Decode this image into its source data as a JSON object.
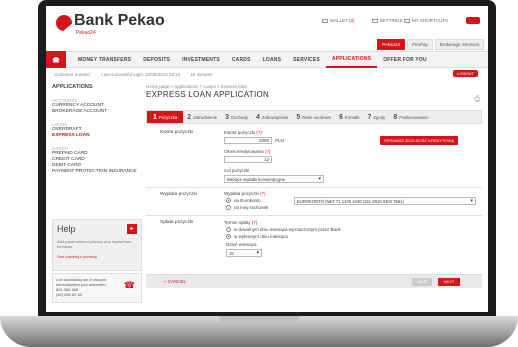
{
  "brand": {
    "name": "Bank Pekao",
    "sub": "Pekao24"
  },
  "util": {
    "wallet_label": "WALLET",
    "wallet_count": "(3)",
    "settings_label": "SETTINGS",
    "management_label": "MY SHORTCUTS"
  },
  "top_tabs": [
    "Pekao24",
    "PeoPay",
    "Brokerage Services"
  ],
  "nav": [
    "MONEY TRANSFERS",
    "DEPOSITS",
    "INVESTMENTS",
    "CARDS",
    "LOANS",
    "SERVICES",
    "APPLICATIONS",
    "OFFER FOR YOU"
  ],
  "info": {
    "customer": "Customer number:",
    "last_login": "Last successful login: 22/05/2014 08:23",
    "session": "15 minutes"
  },
  "logout_label": "LOGOUT",
  "sidebar": {
    "head": "APPLICATIONS",
    "groups": [
      {
        "title": "ACCOUNTS",
        "items": [
          "CURRENCY ACCOUNT",
          "BROKERAGE ACCOUNT"
        ]
      },
      {
        "title": "LOANS",
        "items": [
          "OVERDRAFT",
          "EXPRESS LOAN"
        ]
      },
      {
        "title": "CARDS",
        "items": [
          "PREPAID CARD",
          "CREDIT CARD",
          "DEBIT CARD",
          "PAYMENT PROTECTION INSURANCE"
        ]
      }
    ]
  },
  "help": {
    "title": "Help",
    "text": "Add parametrized primary any mysterious formulas",
    "link": "See udzieliq z pomocy"
  },
  "contact": {
    "text": "Lub skontaktuj sie z naszym konsultantem pod numerem:",
    "phone1": "801 365 365",
    "phone2": "(42) 683 82 82"
  },
  "main": {
    "breadcrumb": "Home page > Applications > Loans > Express loan",
    "title": "EXPRESS LOAN APPLICATION",
    "steps": [
      {
        "num": "1",
        "label": "Pożyczka"
      },
      {
        "num": "2",
        "label": "Zatrudnienie"
      },
      {
        "num": "3",
        "label": "Dochody"
      },
      {
        "num": "4",
        "label": "Zobowiązania"
      },
      {
        "num": "5",
        "label": "Dane osobowe"
      },
      {
        "num": "6",
        "label": "Kontakt"
      },
      {
        "num": "7",
        "label": "Zgody"
      },
      {
        "num": "8",
        "label": "Podsumowanie"
      }
    ]
  },
  "form": {
    "loan": {
      "section": "Kwota pożyczki",
      "amount_label": "Kwota pożyczki",
      "amount_hint": "(?)",
      "amount_value": "2000",
      "currency": "PLN",
      "check_button": "SPRAWDŹ ZDOLNOŚĆ KREDYTOWĄ",
      "period_label": "Okres kredytowania",
      "period_hint": "(?)",
      "period_value": "12",
      "purpose_label": "Cel pożyczki",
      "purpose_value": "Bieżące wydatki konsumpcyjne"
    },
    "payout": {
      "section": "Wypłata pożyczki",
      "label": "Wypłata pożyczki",
      "hint": "(?)",
      "option1": "na Eurokonto",
      "option2": "na inny rachunek",
      "account": "EUROKONTO (NET 71 1240 1040 1111 0010 0402 7561)"
    },
    "repayment": {
      "section": "Spłata pożyczki",
      "label": "Termin spłaty",
      "hint": "(?)",
      "option1": "w dowolnym dniu miesiąca wyznaczonym przez Bank",
      "option2": "w wybranym dniu miesiąca",
      "day_label": "Dzień miesiąca",
      "day_value": "15"
    }
  },
  "footer": {
    "cancel": "CANCEL",
    "save": "SAVE",
    "next": "NEXT"
  }
}
